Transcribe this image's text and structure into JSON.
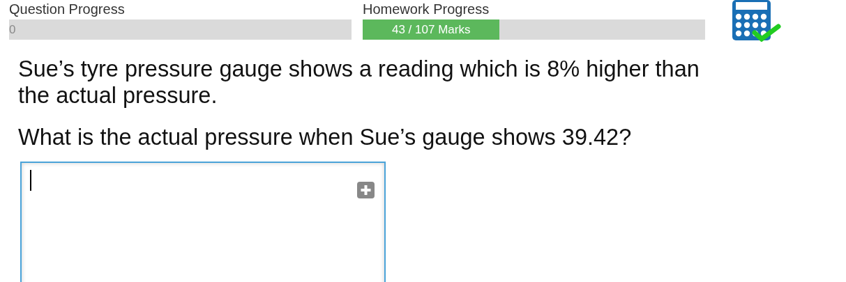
{
  "progress": [
    {
      "label": "Question Progress",
      "text": "0"
    },
    {
      "label": "Homework Progress",
      "text": "43 / 107 Marks",
      "level": 0.4
    }
  ],
  "question": {
    "paragraphs": [
      "Sue’s tyre pressure gauge shows a reading which is 8% higher than the actual pressure.",
      "What is the actual pressure when Sue’s gauge shows 39.42?"
    ]
  },
  "answer": {
    "focused": true
  }
}
